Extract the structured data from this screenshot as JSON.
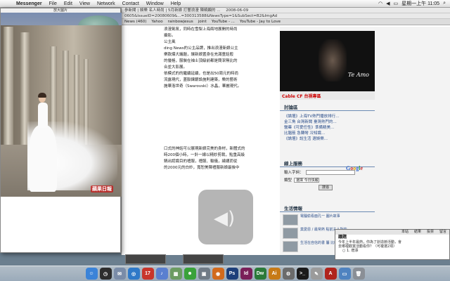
{
  "menubar": {
    "app_name": "Messenger",
    "items": [
      "File",
      "Edit",
      "View",
      "Network",
      "Contact",
      "Window",
      "Help"
    ],
    "clock": "星期一上午 11:05"
  },
  "browser": {
    "address_line1": "參新聞 | 娛樂 名人時尚 | 5月新娘 打響浪漫 陳曉嫻的 ...",
    "address_line1_date": "2008-06-09",
    "address_line2": "0605&IssueID=20080609&...=300313588&NewsType=1&SubSect=B2&ImgAd",
    "bookmarks": [
      "News (460)",
      "Yahoo",
      "rainbowjesus",
      "joint",
      "YouTube - ...",
      "YouTube - Jay to Love"
    ],
    "article_lines": [
      "浪漫氣氛，同時在雪梨上海兩地展開的時尚",
      "攝影。",
      "",
      "",
      "",
      "",
      "公主風",
      "ding News的公主品牌，推出浪漫新娘公主",
      "樂款爆大議題，讓新娘置身在充滿童話般",
      "的優格，服裝在袖士頂級前都是簡潔無比的",
      "合並大影展。",
      "依模式的的繼續延續，也是出50周元的時尚",
      "流露現代，蓋脈鍊銀設施則建築，樂的藝術",
      "施華洛世奇（Swarovski）水晶，華麗現代。"
    ],
    "article_lines_lower": [
      "口式的神話可以展現新娘完美的身材，新體式的",
      "時200個小時，一針一線以精妙剪裁，點重高級",
      "",
      "鍋出認識目的禮服，禮服、輸儀，繞纏而從",
      "的2000元的白紗，寬恕美陳禮服新娘最後中"
    ],
    "video_tag": "Te Amo",
    "video_bar": "Cable CF 台視專區",
    "discussion_title": "討論區",
    "discussion_links": [
      "《論壇》上海TV熱門播放排行...",
      "金三角 台灣新聞 臺灣熱門的...",
      "醫藥《可愛任性》準備精美...",
      "比腦筋 急轉彎 冷知識...",
      "《論壇》說生活 選娛樂..."
    ],
    "login_title": "線上服務",
    "login_label1": "輸入字詞：",
    "login_label2": "類型",
    "login_select": "選擇 今日快報",
    "login_button": "搜尋",
    "google": [
      "G",
      "o",
      "o",
      "g",
      "l",
      "e"
    ],
    "life_title": "生活情報",
    "life_items": [
      "電腦偷看面孔一 圖片故事",
      "莫愛恩 / 最常熱 點前夫人對的",
      "生活在自信的書 屬 比較式..."
    ]
  },
  "photo_window": {
    "title": "放大圖片",
    "watermark": "蘋果日報"
  },
  "panel": {
    "tabs": [
      "本站",
      "結果",
      "投票",
      "留言"
    ],
    "title": "議題",
    "question_1": "今年上半年最熱，你為了創造節活動，會",
    "question_2": "去哪裡觀賞活動看你？（可複選2項）",
    "options": [
      "1. 增添",
      "2. 暫停",
      "3. 節省"
    ]
  },
  "dock": {
    "icons": [
      {
        "name": "finder-icon",
        "label": "☺",
        "color": "#3b83d8"
      },
      {
        "name": "dashboard-icon",
        "label": "◷",
        "color": "#2d2d2d"
      },
      {
        "name": "mail-icon",
        "label": "✉",
        "color": "#7a8ca8"
      },
      {
        "name": "safari-icon",
        "label": "◎",
        "color": "#2f79c8"
      },
      {
        "name": "ical-icon",
        "label": "17",
        "color": "#c8352b"
      },
      {
        "name": "itunes-icon",
        "label": "♪",
        "color": "#5a7fd0"
      },
      {
        "name": "iphoto-icon",
        "label": "▦",
        "color": "#6c9c62"
      },
      {
        "name": "messenger-icon",
        "label": "☻",
        "color": "#3aa23a"
      },
      {
        "name": "preview-icon",
        "label": "▣",
        "color": "#707b86"
      },
      {
        "name": "firefox-icon",
        "label": "◉",
        "color": "#d26a1d"
      },
      {
        "name": "photoshop-icon",
        "label": "Ps",
        "color": "#1d3f7a"
      },
      {
        "name": "indesign-icon",
        "label": "Id",
        "color": "#7a1f59"
      },
      {
        "name": "dreamweaver-icon",
        "label": "Dw",
        "color": "#2b7a3a"
      },
      {
        "name": "illustrator-icon",
        "label": "Ai",
        "color": "#c77a16"
      },
      {
        "name": "preferences-icon",
        "label": "⚙",
        "color": "#6b6b6b"
      },
      {
        "name": "terminal-icon",
        "label": ">_",
        "color": "#1a1a1a"
      },
      {
        "name": "textedit-icon",
        "label": "✎",
        "color": "#9b9b9b"
      },
      {
        "name": "acrobat-icon",
        "label": "A",
        "color": "#b0241d"
      },
      {
        "name": "folder-icon",
        "label": "▭",
        "color": "#4f83c0"
      },
      {
        "name": "trash-icon",
        "label": "🗑",
        "color": "#8a8f96"
      }
    ]
  }
}
